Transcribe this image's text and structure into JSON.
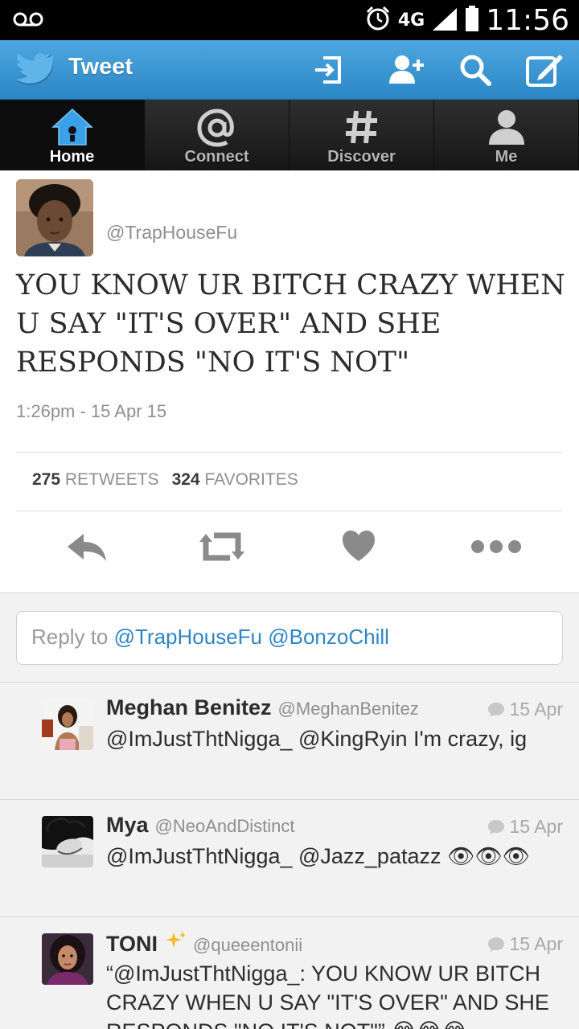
{
  "status_bar": {
    "network": "4G",
    "time": "11:56"
  },
  "action_bar": {
    "title": "Tweet"
  },
  "tabs": [
    {
      "label": "Home"
    },
    {
      "label": "Connect"
    },
    {
      "label": "Discover"
    },
    {
      "label": "Me"
    }
  ],
  "tweet": {
    "handle": "@TrapHouseFu",
    "text": "YOU KNOW UR BITCH CRAZY WHEN U SAY \"IT'S OVER\" AND SHE RESPONDS \"NO IT'S NOT\"",
    "timestamp": "1:26pm - 15 Apr 15",
    "retweets_count": "275",
    "retweets_label": "RETWEETS",
    "favorites_count": "324",
    "favorites_label": "FAVORITES"
  },
  "reply_box": {
    "prefix": "Reply to ",
    "mentions": "@TrapHouseFu @BonzoChill"
  },
  "replies": [
    {
      "name": "Meghan Benitez",
      "handle": "@MeghanBenitez",
      "date": "15 Apr",
      "text": "@ImJustThtNigga_ @KingRyin I'm crazy, ig"
    },
    {
      "name": "Mya",
      "handle": "@NeoAndDistinct",
      "date": "15 Apr",
      "text": "@ImJustThtNigga_ @Jazz_patazz 👁👁👁"
    },
    {
      "name": "TONI",
      "handle": "@queeentonii",
      "date": "15 Apr",
      "text": "“@ImJustThtNigga_: YOU KNOW UR BITCH CRAZY WHEN U SAY \"IT'S OVER\" AND SHE RESPONDS \"NO IT'S NOT\"” 😂😂😂"
    }
  ],
  "colors": {
    "action_bar": "#2b86c5",
    "link": "#2e85c4",
    "tab_bg": "#1a1a1a"
  },
  "icons": [
    "voicemail-icon",
    "alarm-icon",
    "signal-icon",
    "battery-icon",
    "twitter-bird-icon",
    "sign-in-icon",
    "add-user-icon",
    "search-icon",
    "compose-icon",
    "home-icon",
    "at-icon",
    "hash-icon",
    "person-icon",
    "reply-icon",
    "retweet-icon",
    "heart-icon",
    "more-icon",
    "comment-icon"
  ]
}
